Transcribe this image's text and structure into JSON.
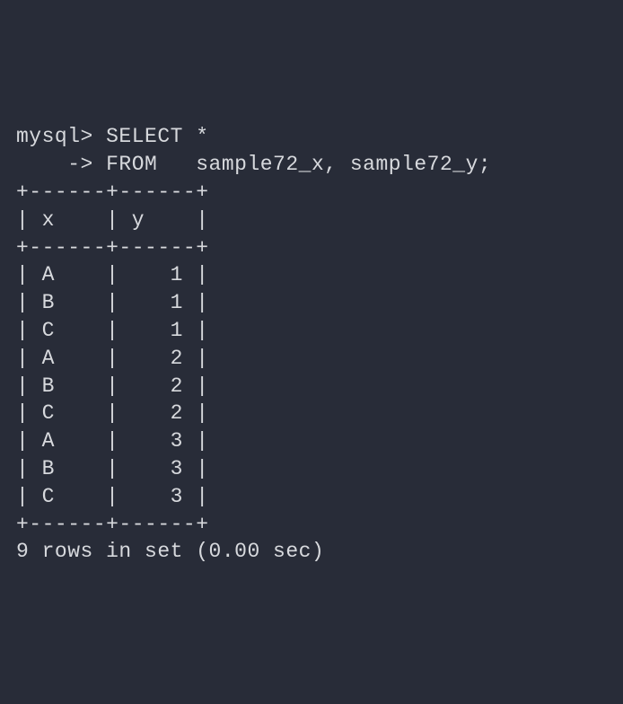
{
  "terminal": {
    "prompt": "mysql> ",
    "continuation_prompt": "    -> ",
    "query_line1": "SELECT *",
    "query_line2": "FROM   sample72_x, sample72_y;",
    "table_border_top": "+------+------+",
    "table_header": "| x    | y    |",
    "table_border_mid": "+------+------+",
    "rows": [
      "| A    |    1 |",
      "| B    |    1 |",
      "| C    |    1 |",
      "| A    |    2 |",
      "| B    |    2 |",
      "| C    |    2 |",
      "| A    |    3 |",
      "| B    |    3 |",
      "| C    |    3 |"
    ],
    "table_border_bottom": "+------+------+",
    "footer": "9 rows in set (0.00 sec)"
  },
  "chart_data": {
    "type": "table",
    "columns": [
      "x",
      "y"
    ],
    "data": [
      {
        "x": "A",
        "y": 1
      },
      {
        "x": "B",
        "y": 1
      },
      {
        "x": "C",
        "y": 1
      },
      {
        "x": "A",
        "y": 2
      },
      {
        "x": "B",
        "y": 2
      },
      {
        "x": "C",
        "y": 2
      },
      {
        "x": "A",
        "y": 3
      },
      {
        "x": "B",
        "y": 3
      },
      {
        "x": "C",
        "y": 3
      }
    ],
    "row_count": 9,
    "elapsed_sec": 0.0,
    "query": "SELECT * FROM sample72_x, sample72_y;"
  }
}
